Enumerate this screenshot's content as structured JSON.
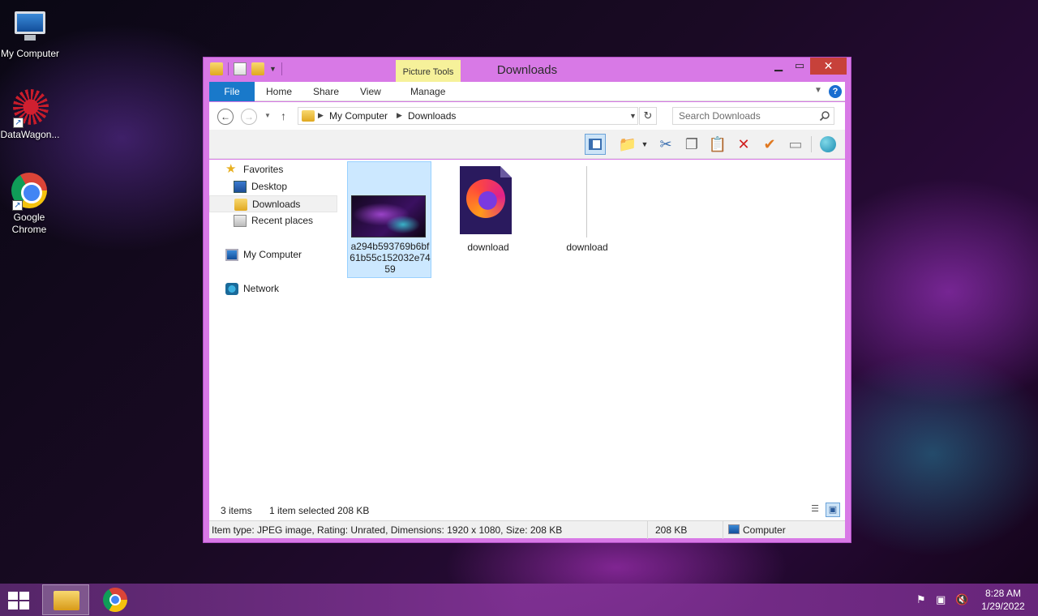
{
  "desktop": {
    "icons": [
      {
        "label": "My Computer"
      },
      {
        "label": "DataWagon..."
      },
      {
        "label": "Google Chrome"
      }
    ]
  },
  "window": {
    "title": "Downloads",
    "contextual_tab": "Picture Tools",
    "close_glyph": "✕",
    "ribbon": {
      "tabs": [
        "File",
        "Home",
        "Share",
        "View",
        "Manage"
      ]
    },
    "address": {
      "segments": [
        "My Computer",
        "Downloads"
      ]
    },
    "search": {
      "placeholder": "Search Downloads"
    },
    "nav_pane": {
      "items": [
        {
          "label": "Favorites",
          "icon": "star-icon"
        },
        {
          "label": "Desktop",
          "icon": "desktop-icon"
        },
        {
          "label": "Downloads",
          "icon": "downloads-folder-icon",
          "selected": true
        },
        {
          "label": "Recent places",
          "icon": "recent-places-icon"
        },
        {
          "label": "My Computer",
          "icon": "computer-icon"
        },
        {
          "label": "Network",
          "icon": "network-icon"
        }
      ]
    },
    "files": [
      {
        "name": "a294b593769b6bf61b55c152032e7459",
        "type": "jpeg-thumbnail",
        "selected": true
      },
      {
        "name": "download",
        "type": "firefox-installer"
      },
      {
        "name": "download",
        "type": "blank-file"
      }
    ],
    "status": {
      "item_count": "3 items",
      "selection": "1 item selected",
      "selection_size": "208 KB"
    },
    "details_bar": {
      "info": "Item type: JPEG image, Rating: Unrated, Dimensions: 1920 x 1080, Size: 208 KB",
      "size": "208 KB",
      "location": "Computer"
    }
  },
  "taskbar": {
    "time": "8:28 AM",
    "date": "1/29/2022"
  }
}
